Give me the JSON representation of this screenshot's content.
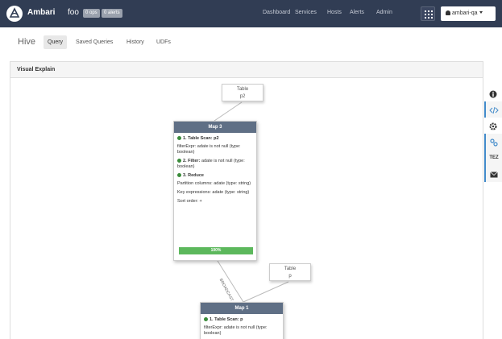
{
  "navbar": {
    "brand": "Ambari",
    "cluster": "foo",
    "ops_badge": "0 ops",
    "alerts_badge": "0 alerts",
    "links": [
      "Dashboard",
      "Services",
      "Hosts",
      "Alerts",
      "Admin"
    ],
    "user": "ambari-qa"
  },
  "subnav": {
    "title": "Hive",
    "tabs": [
      "Query",
      "Saved Queries",
      "History",
      "UDFs"
    ],
    "active_tab": "Query"
  },
  "panel": {
    "title": "Visual Explain"
  },
  "toolbar": {
    "tez_label": "TEZ",
    "icons": [
      "info-icon",
      "code-icon",
      "gear-icon",
      "link-icon",
      "tez",
      "envelope-icon"
    ]
  },
  "graph": {
    "table_p2": {
      "title": "Table",
      "name": "p2"
    },
    "table_p": {
      "title": "Table",
      "name": "p"
    },
    "edge_label": "BROADCAST",
    "map3": {
      "title": "Map 3",
      "op1": "1. Table Scan: p2",
      "op1_detail": "filterExpr: adate is not null (type: boolean)",
      "op2": "2. Filter:",
      "op2_detail": "adate is not null (type: boolean)",
      "op3": "3. Reduce",
      "partition": "Partition columns: adate (type: string)",
      "keys": "Key expressions: adate (type: string)",
      "sort": "Sort order: +",
      "progress_label": "100%",
      "progress": 1.0
    },
    "map1": {
      "title": "Map 1",
      "op1": "1. Table Scan: p",
      "op1_detail": "filterExpr: adate is not null (type: boolean)"
    },
    "colors": {
      "navbar": "#313d54",
      "map_header": "#5f6f85",
      "progress": "#5cb85c",
      "status_dot": "#3a8b3a"
    }
  }
}
